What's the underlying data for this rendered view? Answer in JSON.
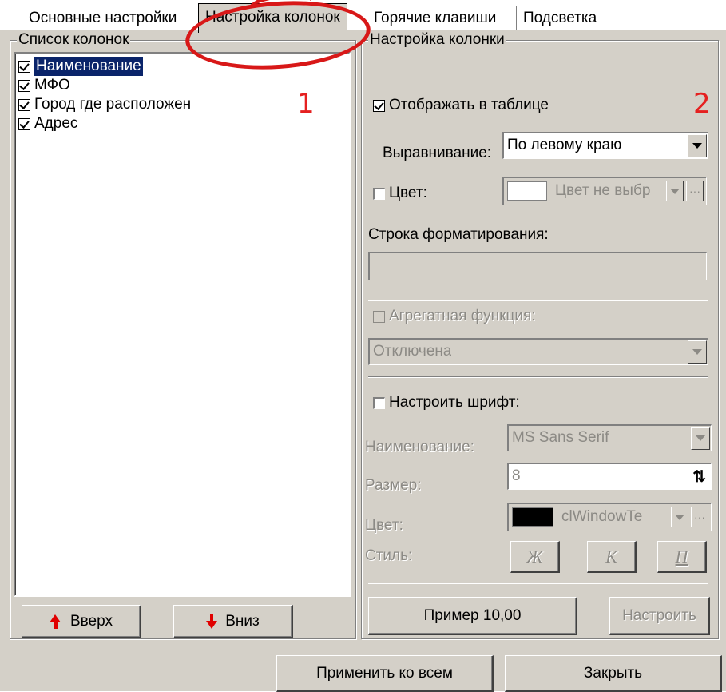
{
  "tabs": [
    {
      "label": "Основные настройки",
      "active": false
    },
    {
      "label": "Настройка колонок",
      "active": true
    },
    {
      "label": "Горячие клавиши",
      "active": false
    },
    {
      "label": "Подсветка",
      "active": false
    }
  ],
  "annotations": {
    "one": "1",
    "two": "2"
  },
  "columns_group": {
    "caption": "Список колонок",
    "items": [
      {
        "label": "Наименование",
        "checked": true,
        "selected": true
      },
      {
        "label": "МФО",
        "checked": true,
        "selected": false
      },
      {
        "label": "Город где расположен",
        "checked": true,
        "selected": false
      },
      {
        "label": "Адрес",
        "checked": true,
        "selected": false
      }
    ],
    "up_label": "Вверх",
    "down_label": "Вниз"
  },
  "column_settings": {
    "caption": "Настройка колонки",
    "show_in_table_label": "Отображать в таблице",
    "show_in_table": true,
    "alignment_label": "Выравнивание:",
    "alignment_value": "По левому краю",
    "color_label": "Цвет:",
    "color_value": "Цвет не выбр",
    "format_label": "Строка форматирования:",
    "format_value": "",
    "aggregate_label": "Агрегатная функция:",
    "aggregate_value": "Отключена",
    "font_label": "Настроить шрифт:",
    "font_name_label": "Наименование:",
    "font_name_value": "MS Sans Serif",
    "font_size_label": "Размер:",
    "font_size_value": "8",
    "font_color_label": "Цвет:",
    "font_color_value": "clWindowTe",
    "font_color_swatch": "#000000",
    "style_label": "Стиль:",
    "style_bold": "Ж",
    "style_italic": "К",
    "style_underline": "П",
    "sample_label": "Пример 10,00",
    "configure_label": "Настроить"
  },
  "footer": {
    "apply_all_label": "Применить ко всем",
    "close_label": "Закрыть"
  }
}
